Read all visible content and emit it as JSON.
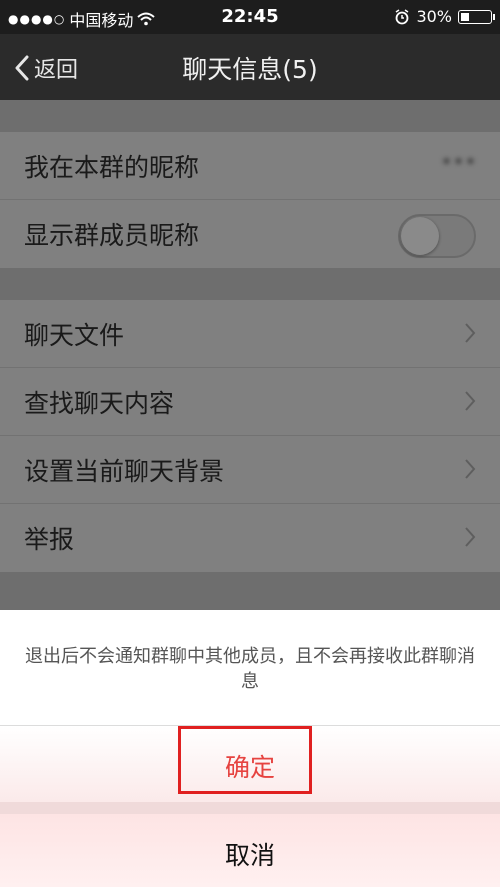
{
  "status_bar": {
    "carrier": "中国移动",
    "time": "22:45",
    "battery_percent": "30%",
    "battery_level": 0.3
  },
  "nav": {
    "back_label": "返回",
    "title": "聊天信息(5)"
  },
  "group1": {
    "nickname_label": "我在本群的昵称",
    "nickname_value": "***",
    "show_nicknames_label": "显示群成员昵称",
    "show_nicknames_on": false
  },
  "group2": {
    "items": [
      {
        "label": "聊天文件"
      },
      {
        "label": "查找聊天内容"
      },
      {
        "label": "设置当前聊天背景"
      },
      {
        "label": "举报"
      }
    ]
  },
  "sheet": {
    "message": "退出后不会通知群聊中其他成员，且不会再接收此群聊消息",
    "confirm_label": "确定",
    "cancel_label": "取消"
  },
  "colors": {
    "confirm_text": "#e64340",
    "highlight_box": "#e02020"
  }
}
